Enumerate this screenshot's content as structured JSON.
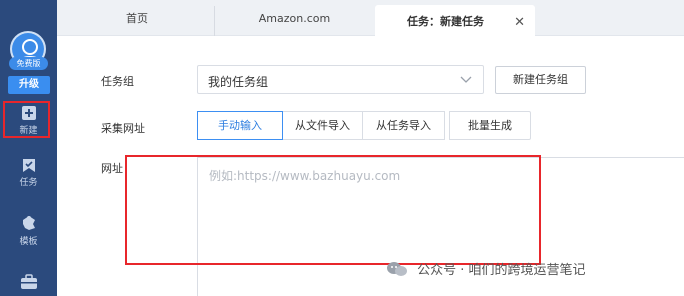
{
  "sidebar": {
    "badge": "免费版",
    "upgrade_label": "升级",
    "items": [
      {
        "label": "新建",
        "icon": "plus-square-icon"
      },
      {
        "label": "任务",
        "icon": "bookmark-icon"
      },
      {
        "label": "模板",
        "icon": "puzzle-icon"
      },
      {
        "label": "",
        "icon": "briefcase-icon"
      }
    ]
  },
  "tabs": [
    {
      "label": "首页"
    },
    {
      "label": "Amazon.com"
    },
    {
      "label": "任务：新建任务",
      "active": true
    }
  ],
  "form": {
    "group_label": "任务组",
    "group_value": "我的任务组",
    "new_group_button": "新建任务组",
    "collect_url_label": "采集网址",
    "options": [
      "手动输入",
      "从文件导入",
      "从任务导入",
      "批量生成"
    ],
    "selected_option": "手动输入",
    "address_label": "网址",
    "url_placeholder": "例如:https://www.bazhuayu.com"
  },
  "watermark": "公众号 · 咱们的跨境运营笔记",
  "colors": {
    "sidebar_bg": "#2b4a7d",
    "accent": "#3d8ff2",
    "highlight_red": "#e8262b"
  }
}
